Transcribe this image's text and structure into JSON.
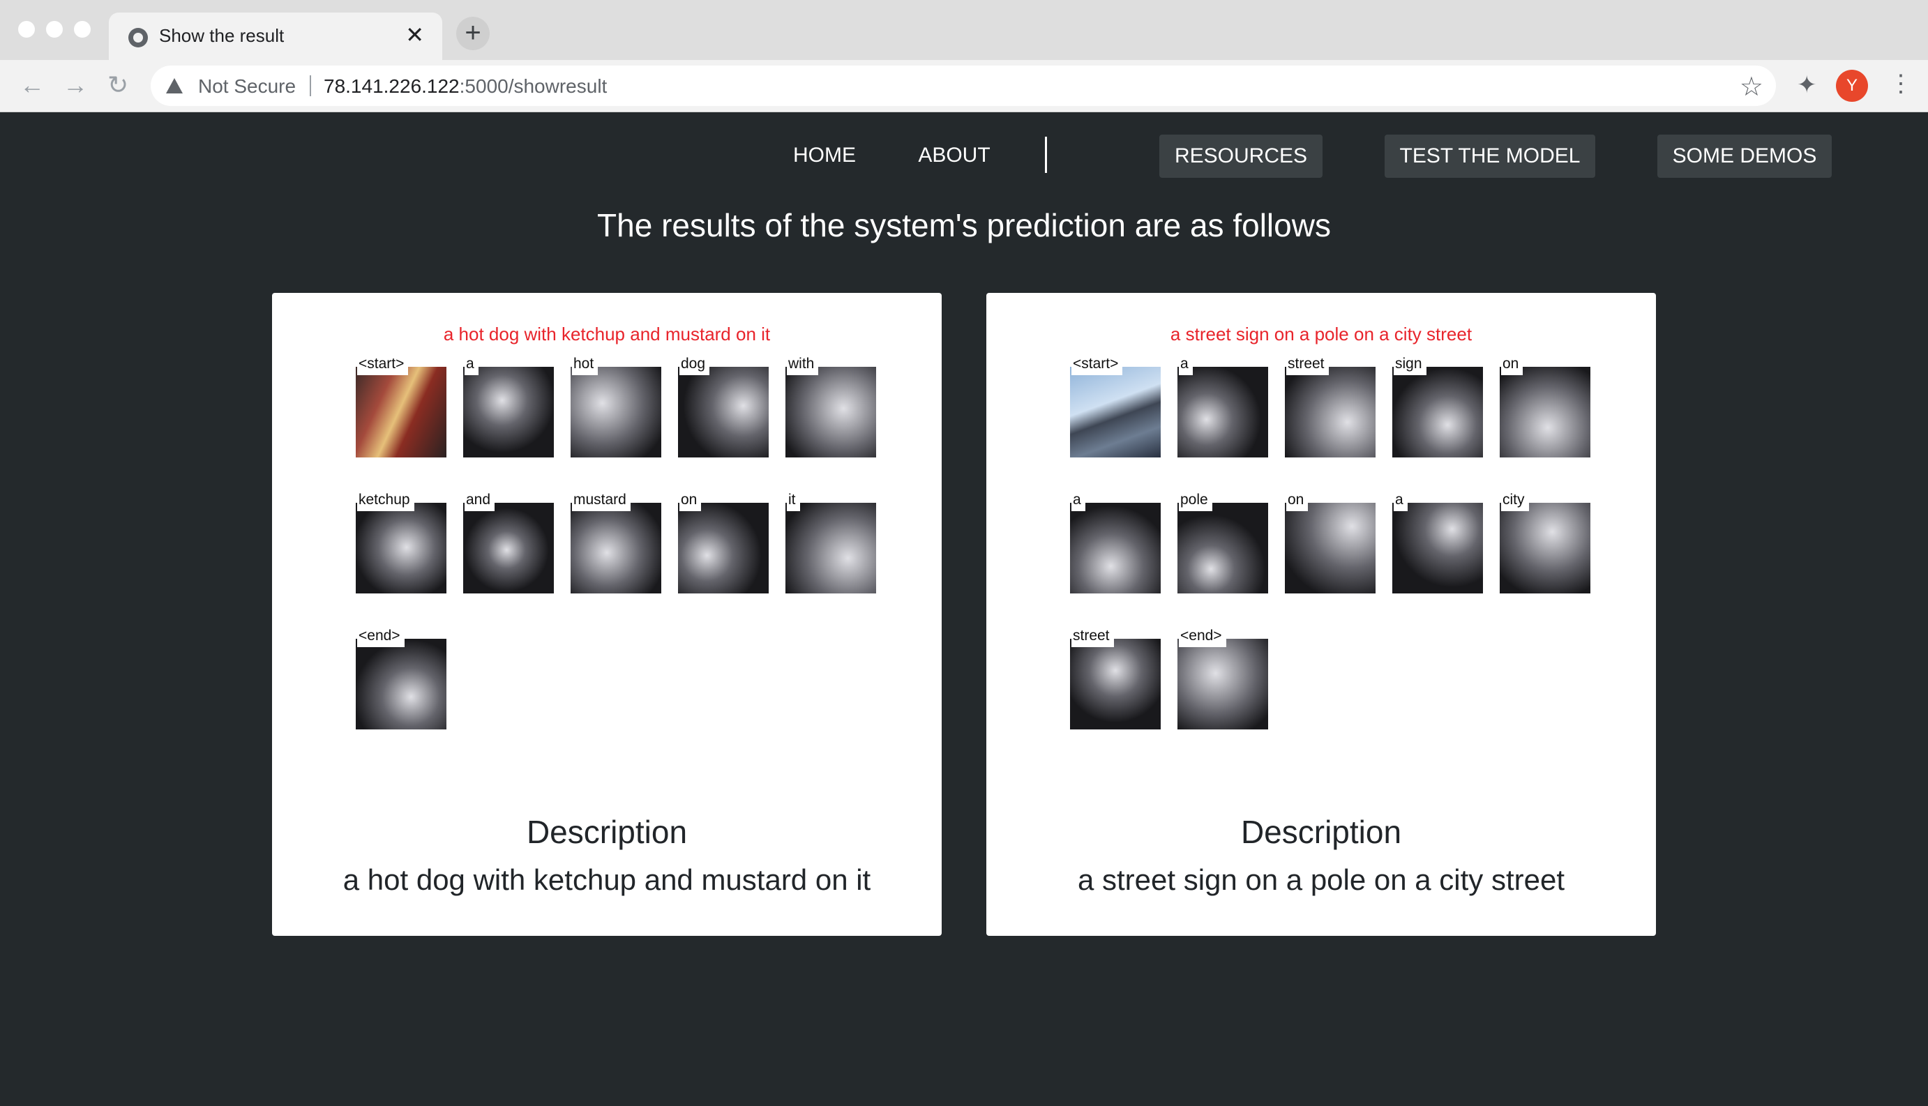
{
  "browser": {
    "tab_title": "Show the result",
    "tab_close": "✕",
    "new_tab": "+",
    "not_secure": "Not Secure",
    "url_host": "78.141.226.122",
    "url_path": ":5000/showresult",
    "avatar_letter": "Y",
    "back": "←",
    "forward": "→",
    "reload": "↻",
    "star": "☆",
    "extensions": "✦",
    "menu": "⋮"
  },
  "nav": {
    "home": "HOME",
    "about": "ABOUT",
    "resources": "RESOURCES",
    "test_model": "TEST THE MODEL",
    "demos": "SOME DEMOS"
  },
  "page": {
    "heading": "The results of the system's prediction are as follows"
  },
  "results": [
    {
      "caption": "a hot dog with ketchup and mustard on it",
      "words": [
        "<start>",
        "a",
        "hot",
        "dog",
        "with",
        "ketchup",
        "and",
        "mustard",
        "on",
        "it",
        "<end>"
      ],
      "description_title": "Description",
      "description": "a hot dog with ketchup and mustard on it"
    },
    {
      "caption": "a street sign on a pole on a city street",
      "words": [
        "<start>",
        "a",
        "street",
        "sign",
        "on",
        "a",
        "pole",
        "on",
        "a",
        "city",
        "street",
        "<end>"
      ],
      "description_title": "Description",
      "description": "a street sign on a pole on a city street"
    }
  ],
  "colors": {
    "page_bg": "#24292c",
    "caption_red": "#e8242b",
    "nav_button_bg": "#3b4144"
  }
}
